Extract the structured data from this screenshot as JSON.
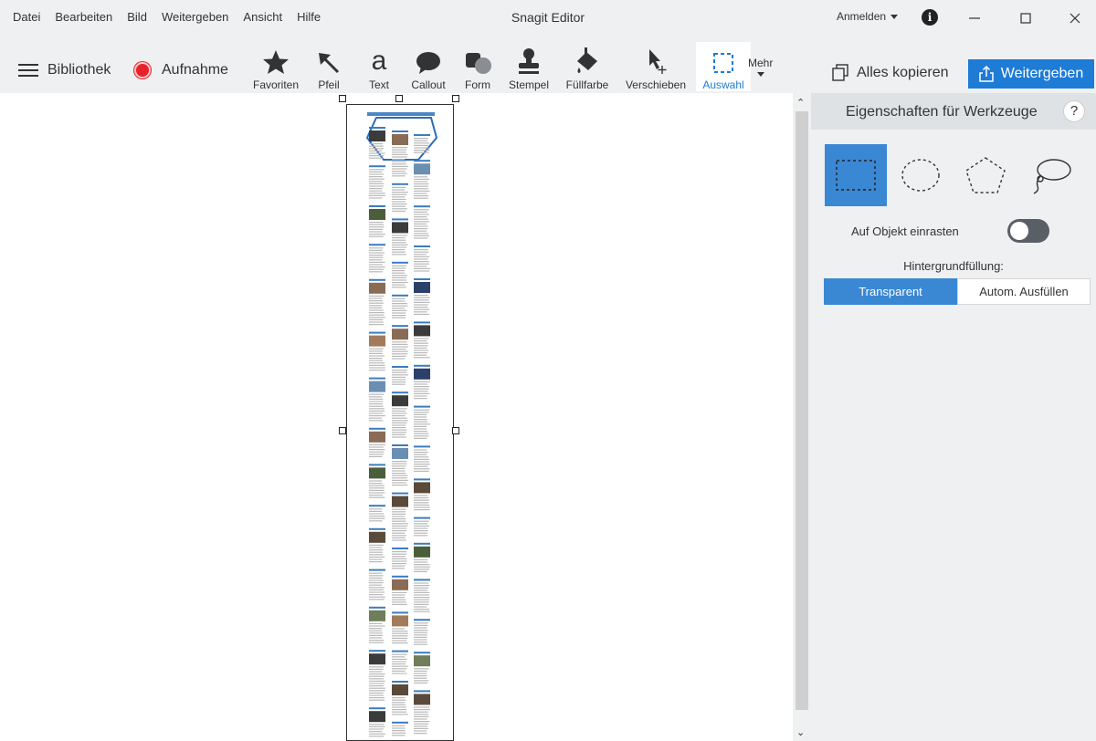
{
  "window": {
    "title": "Snagit Editor",
    "menu": [
      "Datei",
      "Bearbeiten",
      "Bild",
      "Weitergeben",
      "Ansicht",
      "Hilfe"
    ],
    "signin_label": "Anmelden",
    "controls": [
      "minimize-icon",
      "maximize-icon",
      "close-icon"
    ]
  },
  "toolbar": {
    "library_label": "Bibliothek",
    "capture_label": "Aufnahme",
    "tools": [
      {
        "label": "Favoriten",
        "icon": "star-icon"
      },
      {
        "label": "Pfeil",
        "icon": "arrow-icon"
      },
      {
        "label": "Text",
        "icon": "text-icon"
      },
      {
        "label": "Callout",
        "icon": "callout-icon"
      },
      {
        "label": "Form",
        "icon": "shape-icon"
      },
      {
        "label": "Stempel",
        "icon": "stamp-icon"
      },
      {
        "label": "Füllfarbe",
        "icon": "fill-icon"
      },
      {
        "label": "Verschieben",
        "icon": "move-icon"
      },
      {
        "label": "Auswahl",
        "icon": "selection-icon",
        "active": true
      }
    ],
    "more_label": "Mehr",
    "copy_all_label": "Alles kopieren",
    "share_label": "Weitergeben"
  },
  "panel": {
    "title": "Eigenschaften für Werkzeuge",
    "help_label": "?",
    "selection_shapes": [
      "rectangle-selection-icon",
      "ellipse-selection-icon",
      "polygon-selection-icon",
      "lasso-selection-icon"
    ],
    "selected_shape": "rectangle-selection-icon",
    "snap_label": "Auf Objekt einrasten",
    "snap_enabled": false,
    "fill_label": "Hintergrundfüllung:",
    "fill_options": [
      "Transparent",
      "Autom. Ausfüllen"
    ],
    "fill_selected": "Transparent"
  },
  "colors": {
    "accent": "#1e7bd6",
    "panel_selected": "#3a87d4",
    "record": "#e8222a"
  }
}
